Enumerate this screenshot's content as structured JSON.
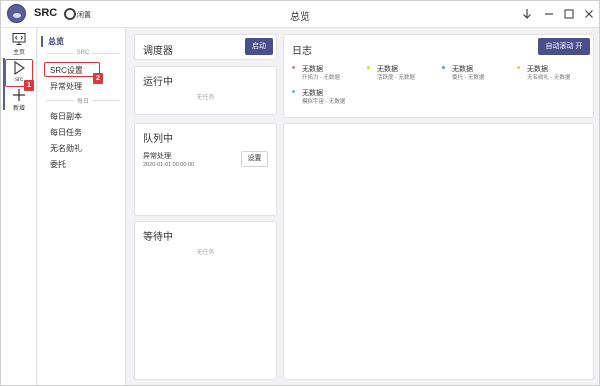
{
  "titlebar": {
    "app_name": "SRC",
    "status": "闲置",
    "window_title": "总览"
  },
  "rail": {
    "items": [
      {
        "label": "主页",
        "icon": "monitor-code-icon"
      },
      {
        "label": "src",
        "icon": "play-icon"
      },
      {
        "label": "新增",
        "icon": "plus-icon"
      }
    ],
    "badge_1": "1"
  },
  "nav": {
    "title": "总览",
    "section_src": "SRC",
    "items_src": [
      "SRC设置",
      "异常处理"
    ],
    "section_daily": "每日",
    "items_daily": [
      "每日副本",
      "每日任务",
      "无名勋礼",
      "委托"
    ],
    "badge_2": "2"
  },
  "scheduler": {
    "title": "调度器",
    "start_button": "启动"
  },
  "running": {
    "title": "运行中",
    "empty": "无任务"
  },
  "queue": {
    "title": "队列中",
    "task_name": "异常处理",
    "task_time": "2020-01-01 00:00:00",
    "settings_button": "设置"
  },
  "waiting": {
    "title": "等待中",
    "empty": "无任务"
  },
  "log": {
    "title": "日志",
    "auto_scroll_button": "自动滚动 开",
    "entries": [
      {
        "main": "无数据",
        "sub": "开拓力 - 无数据",
        "color": "#c57ad6"
      },
      {
        "main": "无数据",
        "sub": "活跃度 - 无数据",
        "color": "#e3d24a"
      },
      {
        "main": "无数据",
        "sub": "委托 - 无数据",
        "color": "#4aa3e0"
      },
      {
        "main": "无数据",
        "sub": "无名勋礼 - 无数据",
        "color": "#e3d24a"
      },
      {
        "main": "无数据",
        "sub": "模拟宇宙 - 无数据",
        "color": "#6cb4e8"
      }
    ]
  },
  "colors": {
    "accent": "#4a4f8c",
    "highlight": "#d33333"
  }
}
